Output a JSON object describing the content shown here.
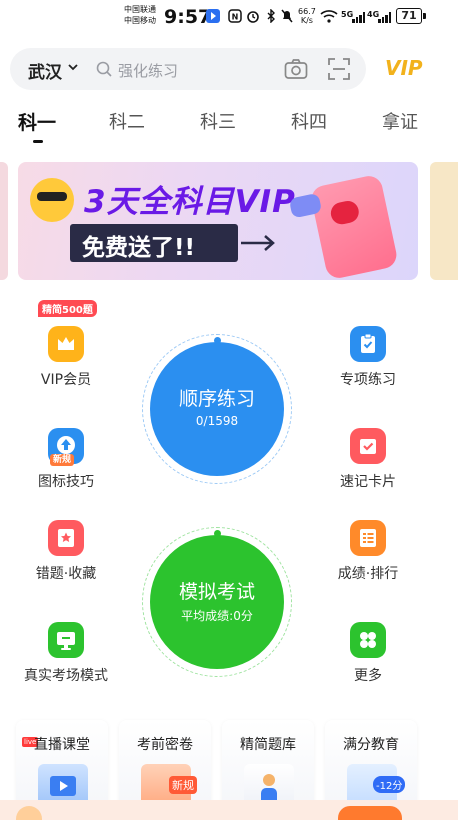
{
  "status_bar": {
    "carrier_1": "中国联通",
    "carrier_2": "中国移动",
    "time": "9:57",
    "net_speed_value": "66.7",
    "net_speed_unit": "K/s",
    "sig1_label": "5G",
    "sig2_label": "4G",
    "battery": "71"
  },
  "header": {
    "city": "武汉",
    "search_placeholder": "强化练习",
    "vip_label": "VIP"
  },
  "tabs": [
    {
      "label": "科一"
    },
    {
      "label": "科二"
    },
    {
      "label": "科三"
    },
    {
      "label": "科四"
    },
    {
      "label": "拿证"
    }
  ],
  "banner": {
    "title": "3天全科目VIP",
    "subtitle": "免费送了!!"
  },
  "grid": {
    "vip_member": {
      "label": "VIP会员",
      "badge": "精简500题"
    },
    "special_practice": {
      "label": "专项练习"
    },
    "icon_tips": {
      "label": "图标技巧",
      "tag": "新规"
    },
    "flash_cards": {
      "label": "速记卡片"
    },
    "mistakes": {
      "label": "错题·收藏"
    },
    "ranking": {
      "label": "成绩·排行"
    },
    "real_exam": {
      "label": "真实考场模式"
    },
    "more": {
      "label": "更多"
    }
  },
  "sequential": {
    "title": "顺序练习",
    "progress": "0/1598",
    "done": 0,
    "total": 1598
  },
  "mock_exam": {
    "title": "模拟考试",
    "average": "平均成绩:0分"
  },
  "cards": [
    {
      "title": "直播课堂",
      "tag": "live"
    },
    {
      "title": "考前密卷",
      "tag": "新规"
    },
    {
      "title": "精简题库"
    },
    {
      "title": "满分教育",
      "tag": "-12分"
    }
  ],
  "colors": {
    "blue": "#2b8ff0",
    "green": "#2cc32e",
    "orange": "#ff8a2a",
    "red": "#ff5151",
    "vip_gold": "#f2b21c"
  }
}
